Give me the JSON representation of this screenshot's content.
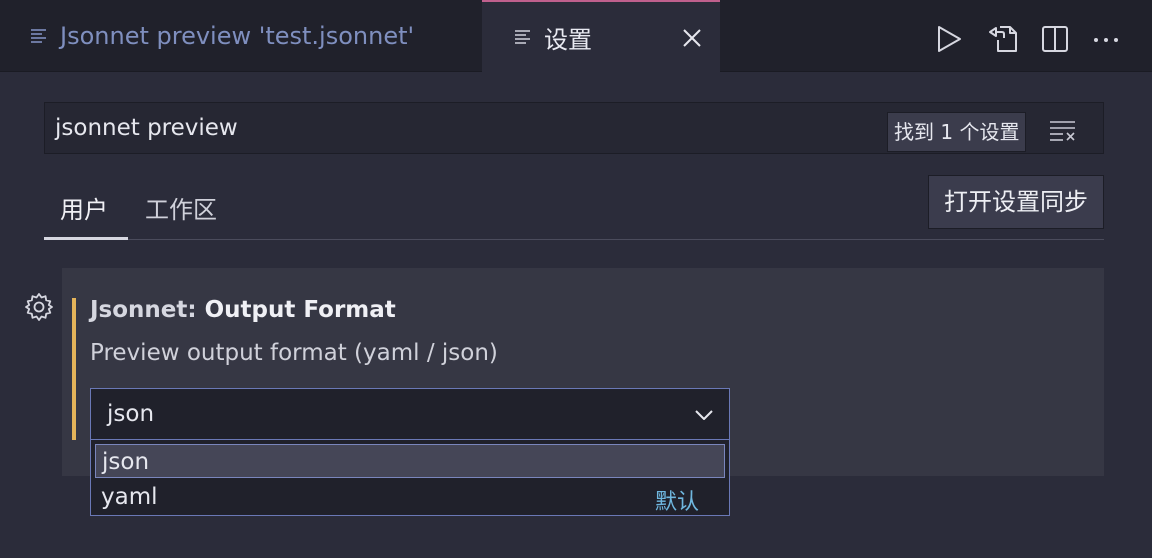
{
  "tabs": {
    "preview_label": "Jsonnet preview 'test.jsonnet'",
    "settings_label": "设置"
  },
  "search": {
    "query": "jsonnet preview",
    "result_count": "找到 1 个设置"
  },
  "scopes": {
    "user": "用户",
    "workspace": "工作区",
    "sync_button": "打开设置同步"
  },
  "setting": {
    "category": "Jsonnet: ",
    "name": "Output Format",
    "description": "Preview output format (yaml / json)",
    "selected": "json",
    "options": [
      {
        "label": "json",
        "default": ""
      },
      {
        "label": "yaml",
        "default": "默认"
      }
    ]
  },
  "colors": {
    "accent_tab": "#c0608d",
    "modified_bar": "#e5b45a",
    "focus_border": "#6a78b6",
    "default_tag": "#6fb7df"
  },
  "icons": [
    "file-lines-icon",
    "close-icon",
    "run-icon",
    "open-source-icon",
    "split-editor-icon",
    "more-icon",
    "clear-filter-icon",
    "gear-icon",
    "chevron-down-icon"
  ]
}
